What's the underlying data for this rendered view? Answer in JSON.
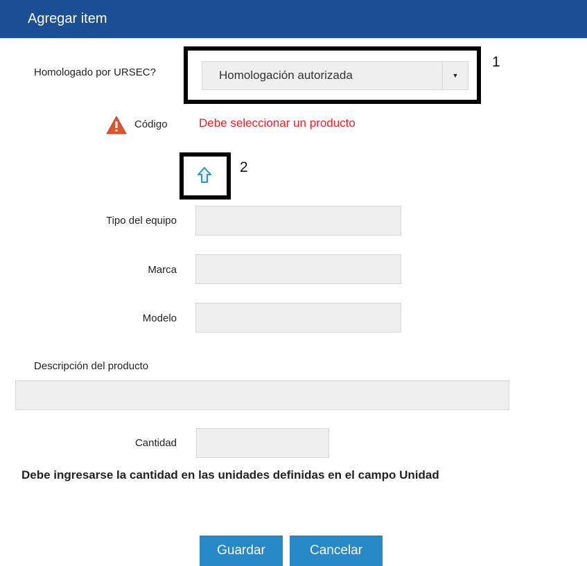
{
  "header": {
    "title": "Agregar item"
  },
  "form": {
    "homologado_label": "Homologado por URSEC?",
    "homologado_selected": "Homologación autorizada",
    "codigo_label": "Código",
    "codigo_error": "Debe seleccionar un producto",
    "tipo_label": "Tipo del equipo",
    "tipo_value": "",
    "marca_label": "Marca",
    "marca_value": "",
    "modelo_label": "Modelo",
    "modelo_value": "",
    "descripcion_label": "Descripción del producto",
    "descripcion_value": "",
    "cantidad_label": "Cantidad",
    "cantidad_value": "",
    "cantidad_note": "Debe ingresarse la cantidad en las unidades definidas en el campo Unidad"
  },
  "annotations": {
    "callout_1": "1",
    "callout_2": "2"
  },
  "buttons": {
    "save": "Guardar",
    "cancel": "Cancelar"
  },
  "icons": {
    "warning": "warning-icon",
    "upload": "upload-arrow-icon",
    "dropdown": "chevron-down-icon"
  },
  "colors": {
    "header": "#1a4f96",
    "error": "#e8212b",
    "button": "#2688c6",
    "warning": "#e0532f",
    "arrow": "#2f8ee0"
  }
}
